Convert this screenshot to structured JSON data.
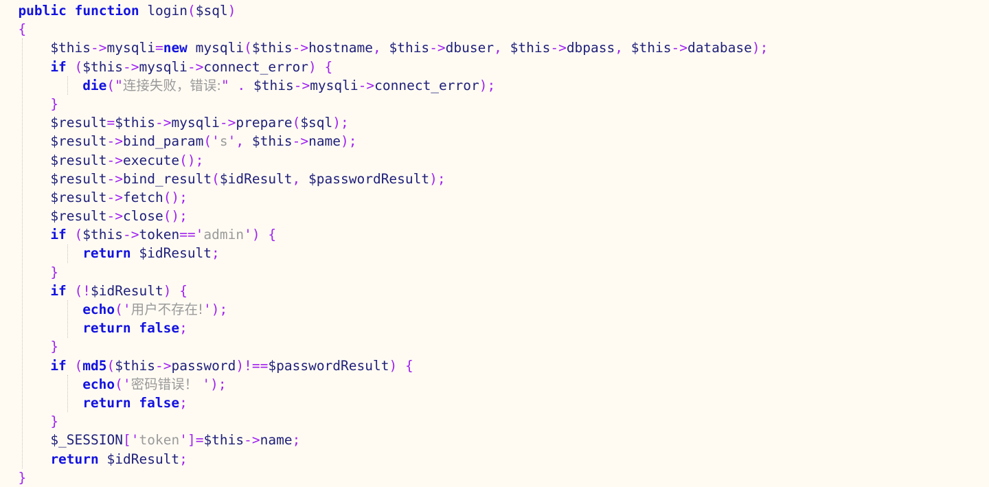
{
  "editor": {
    "language": "php",
    "background_color": "#fffbf3",
    "indent_guide_color": "#c9c4b4",
    "palette": {
      "keyword": "#1212e0",
      "variable": "#20207a",
      "punctuation": "#a020f0",
      "string": "#9a9a9a"
    },
    "indent_guide_columns": [
      32,
      98
    ]
  },
  "code": {
    "lines": [
      {
        "n": 1,
        "indent": 2,
        "tokens": [
          {
            "t": "public",
            "c": "kw"
          },
          {
            "t": " ",
            "c": "plain"
          },
          {
            "t": "function",
            "c": "kw"
          },
          {
            "t": " ",
            "c": "plain"
          },
          {
            "t": "login",
            "c": "var"
          },
          {
            "t": "(",
            "c": "pun"
          },
          {
            "t": "$sql",
            "c": "var"
          },
          {
            "t": ")",
            "c": "pun"
          }
        ]
      },
      {
        "n": 2,
        "indent": 2,
        "tokens": [
          {
            "t": "{",
            "c": "pun"
          }
        ]
      },
      {
        "n": 3,
        "indent": 6,
        "tokens": [
          {
            "t": "$this",
            "c": "var"
          },
          {
            "t": "->",
            "c": "pun"
          },
          {
            "t": "mysqli",
            "c": "var"
          },
          {
            "t": "=",
            "c": "pun"
          },
          {
            "t": "new",
            "c": "kw"
          },
          {
            "t": " mysqli",
            "c": "var"
          },
          {
            "t": "(",
            "c": "pun"
          },
          {
            "t": "$this",
            "c": "var"
          },
          {
            "t": "->",
            "c": "pun"
          },
          {
            "t": "hostname",
            "c": "var"
          },
          {
            "t": ",",
            "c": "pun"
          },
          {
            "t": " $this",
            "c": "var"
          },
          {
            "t": "->",
            "c": "pun"
          },
          {
            "t": "dbuser",
            "c": "var"
          },
          {
            "t": ",",
            "c": "pun"
          },
          {
            "t": " $this",
            "c": "var"
          },
          {
            "t": "->",
            "c": "pun"
          },
          {
            "t": "dbpass",
            "c": "var"
          },
          {
            "t": ",",
            "c": "pun"
          },
          {
            "t": " $this",
            "c": "var"
          },
          {
            "t": "->",
            "c": "pun"
          },
          {
            "t": "database",
            "c": "var"
          },
          {
            "t": ");",
            "c": "pun"
          }
        ]
      },
      {
        "n": 4,
        "indent": 6,
        "tokens": [
          {
            "t": "if",
            "c": "kw"
          },
          {
            "t": " ",
            "c": "plain"
          },
          {
            "t": "(",
            "c": "pun"
          },
          {
            "t": "$this",
            "c": "var"
          },
          {
            "t": "->",
            "c": "pun"
          },
          {
            "t": "mysqli",
            "c": "var"
          },
          {
            "t": "->",
            "c": "pun"
          },
          {
            "t": "connect_error",
            "c": "var"
          },
          {
            "t": ")",
            "c": "pun"
          },
          {
            "t": " ",
            "c": "plain"
          },
          {
            "t": "{",
            "c": "pun"
          }
        ]
      },
      {
        "n": 5,
        "indent": 10,
        "tokens": [
          {
            "t": "die",
            "c": "kw"
          },
          {
            "t": "(",
            "c": "pun"
          },
          {
            "t": "\"",
            "c": "pun"
          },
          {
            "t": "连接失败，错误:",
            "c": "str cjk"
          },
          {
            "t": "\"",
            "c": "pun"
          },
          {
            "t": " ",
            "c": "plain"
          },
          {
            "t": ".",
            "c": "pun"
          },
          {
            "t": " $this",
            "c": "var"
          },
          {
            "t": "->",
            "c": "pun"
          },
          {
            "t": "mysqli",
            "c": "var"
          },
          {
            "t": "->",
            "c": "pun"
          },
          {
            "t": "connect_error",
            "c": "var"
          },
          {
            "t": ");",
            "c": "pun"
          }
        ]
      },
      {
        "n": 6,
        "indent": 6,
        "tokens": [
          {
            "t": "}",
            "c": "pun"
          }
        ]
      },
      {
        "n": 7,
        "indent": 6,
        "tokens": [
          {
            "t": "$result",
            "c": "var"
          },
          {
            "t": "=",
            "c": "pun"
          },
          {
            "t": "$this",
            "c": "var"
          },
          {
            "t": "->",
            "c": "pun"
          },
          {
            "t": "mysqli",
            "c": "var"
          },
          {
            "t": "->",
            "c": "pun"
          },
          {
            "t": "prepare",
            "c": "var"
          },
          {
            "t": "(",
            "c": "pun"
          },
          {
            "t": "$sql",
            "c": "var"
          },
          {
            "t": ");",
            "c": "pun"
          }
        ]
      },
      {
        "n": 8,
        "indent": 6,
        "tokens": [
          {
            "t": "$result",
            "c": "var"
          },
          {
            "t": "->",
            "c": "pun"
          },
          {
            "t": "bind_param",
            "c": "var"
          },
          {
            "t": "(",
            "c": "pun"
          },
          {
            "t": "'",
            "c": "pun"
          },
          {
            "t": "s",
            "c": "str"
          },
          {
            "t": "'",
            "c": "pun"
          },
          {
            "t": ",",
            "c": "pun"
          },
          {
            "t": " $this",
            "c": "var"
          },
          {
            "t": "->",
            "c": "pun"
          },
          {
            "t": "name",
            "c": "var"
          },
          {
            "t": ");",
            "c": "pun"
          }
        ]
      },
      {
        "n": 9,
        "indent": 6,
        "tokens": [
          {
            "t": "$result",
            "c": "var"
          },
          {
            "t": "->",
            "c": "pun"
          },
          {
            "t": "execute",
            "c": "var"
          },
          {
            "t": "();",
            "c": "pun"
          }
        ]
      },
      {
        "n": 10,
        "indent": 6,
        "tokens": [
          {
            "t": "$result",
            "c": "var"
          },
          {
            "t": "->",
            "c": "pun"
          },
          {
            "t": "bind_result",
            "c": "var"
          },
          {
            "t": "(",
            "c": "pun"
          },
          {
            "t": "$idResult",
            "c": "var"
          },
          {
            "t": ",",
            "c": "pun"
          },
          {
            "t": " $passwordResult",
            "c": "var"
          },
          {
            "t": ");",
            "c": "pun"
          }
        ]
      },
      {
        "n": 11,
        "indent": 6,
        "tokens": [
          {
            "t": "$result",
            "c": "var"
          },
          {
            "t": "->",
            "c": "pun"
          },
          {
            "t": "fetch",
            "c": "var"
          },
          {
            "t": "();",
            "c": "pun"
          }
        ]
      },
      {
        "n": 12,
        "indent": 6,
        "tokens": [
          {
            "t": "$result",
            "c": "var"
          },
          {
            "t": "->",
            "c": "pun"
          },
          {
            "t": "close",
            "c": "var"
          },
          {
            "t": "();",
            "c": "pun"
          }
        ]
      },
      {
        "n": 13,
        "indent": 6,
        "tokens": [
          {
            "t": "if",
            "c": "kw"
          },
          {
            "t": " ",
            "c": "plain"
          },
          {
            "t": "(",
            "c": "pun"
          },
          {
            "t": "$this",
            "c": "var"
          },
          {
            "t": "->",
            "c": "pun"
          },
          {
            "t": "token",
            "c": "var"
          },
          {
            "t": "==",
            "c": "pun"
          },
          {
            "t": "'",
            "c": "pun"
          },
          {
            "t": "admin",
            "c": "str"
          },
          {
            "t": "'",
            "c": "pun"
          },
          {
            "t": ")",
            "c": "pun"
          },
          {
            "t": " ",
            "c": "plain"
          },
          {
            "t": "{",
            "c": "pun"
          }
        ]
      },
      {
        "n": 14,
        "indent": 10,
        "tokens": [
          {
            "t": "return",
            "c": "kw"
          },
          {
            "t": " $idResult",
            "c": "var"
          },
          {
            "t": ";",
            "c": "pun"
          }
        ]
      },
      {
        "n": 15,
        "indent": 6,
        "tokens": [
          {
            "t": "}",
            "c": "pun"
          }
        ]
      },
      {
        "n": 16,
        "indent": 6,
        "tokens": [
          {
            "t": "if",
            "c": "kw"
          },
          {
            "t": " ",
            "c": "plain"
          },
          {
            "t": "(!",
            "c": "pun"
          },
          {
            "t": "$idResult",
            "c": "var"
          },
          {
            "t": ")",
            "c": "pun"
          },
          {
            "t": " ",
            "c": "plain"
          },
          {
            "t": "{",
            "c": "pun"
          }
        ]
      },
      {
        "n": 17,
        "indent": 10,
        "tokens": [
          {
            "t": "echo",
            "c": "kw"
          },
          {
            "t": "(",
            "c": "pun"
          },
          {
            "t": "'",
            "c": "pun"
          },
          {
            "t": "用户不存在!",
            "c": "str cjk"
          },
          {
            "t": "'",
            "c": "pun"
          },
          {
            "t": ");",
            "c": "pun"
          }
        ]
      },
      {
        "n": 18,
        "indent": 10,
        "tokens": [
          {
            "t": "return",
            "c": "kw"
          },
          {
            "t": " ",
            "c": "plain"
          },
          {
            "t": "false",
            "c": "kw"
          },
          {
            "t": ";",
            "c": "pun"
          }
        ]
      },
      {
        "n": 19,
        "indent": 6,
        "tokens": [
          {
            "t": "}",
            "c": "pun"
          }
        ]
      },
      {
        "n": 20,
        "indent": 6,
        "tokens": [
          {
            "t": "if",
            "c": "kw"
          },
          {
            "t": " ",
            "c": "plain"
          },
          {
            "t": "(",
            "c": "pun"
          },
          {
            "t": "md5",
            "c": "kw"
          },
          {
            "t": "(",
            "c": "pun"
          },
          {
            "t": "$this",
            "c": "var"
          },
          {
            "t": "->",
            "c": "pun"
          },
          {
            "t": "password",
            "c": "var"
          },
          {
            "t": ")",
            "c": "pun"
          },
          {
            "t": "!==",
            "c": "pun"
          },
          {
            "t": "$passwordResult",
            "c": "var"
          },
          {
            "t": ")",
            "c": "pun"
          },
          {
            "t": " ",
            "c": "plain"
          },
          {
            "t": "{",
            "c": "pun"
          }
        ]
      },
      {
        "n": 21,
        "indent": 10,
        "tokens": [
          {
            "t": "echo",
            "c": "kw"
          },
          {
            "t": "(",
            "c": "pun"
          },
          {
            "t": "'",
            "c": "pun"
          },
          {
            "t": "密码错误！ ",
            "c": "str cjk"
          },
          {
            "t": "'",
            "c": "pun"
          },
          {
            "t": ");",
            "c": "pun"
          }
        ]
      },
      {
        "n": 22,
        "indent": 10,
        "tokens": [
          {
            "t": "return",
            "c": "kw"
          },
          {
            "t": " ",
            "c": "plain"
          },
          {
            "t": "false",
            "c": "kw"
          },
          {
            "t": ";",
            "c": "pun"
          }
        ]
      },
      {
        "n": 23,
        "indent": 6,
        "tokens": [
          {
            "t": "}",
            "c": "pun"
          }
        ]
      },
      {
        "n": 24,
        "indent": 6,
        "tokens": [
          {
            "t": "$_SESSION",
            "c": "var"
          },
          {
            "t": "[",
            "c": "pun"
          },
          {
            "t": "'",
            "c": "pun"
          },
          {
            "t": "token",
            "c": "str"
          },
          {
            "t": "'",
            "c": "pun"
          },
          {
            "t": "]",
            "c": "pun"
          },
          {
            "t": "=",
            "c": "pun"
          },
          {
            "t": "$this",
            "c": "var"
          },
          {
            "t": "->",
            "c": "pun"
          },
          {
            "t": "name",
            "c": "var"
          },
          {
            "t": ";",
            "c": "pun"
          }
        ]
      },
      {
        "n": 25,
        "indent": 6,
        "tokens": [
          {
            "t": "return",
            "c": "kw"
          },
          {
            "t": " $idResult",
            "c": "var"
          },
          {
            "t": ";",
            "c": "pun"
          }
        ]
      },
      {
        "n": 26,
        "indent": 2,
        "tokens": [
          {
            "t": "}",
            "c": "pun"
          }
        ]
      }
    ]
  }
}
